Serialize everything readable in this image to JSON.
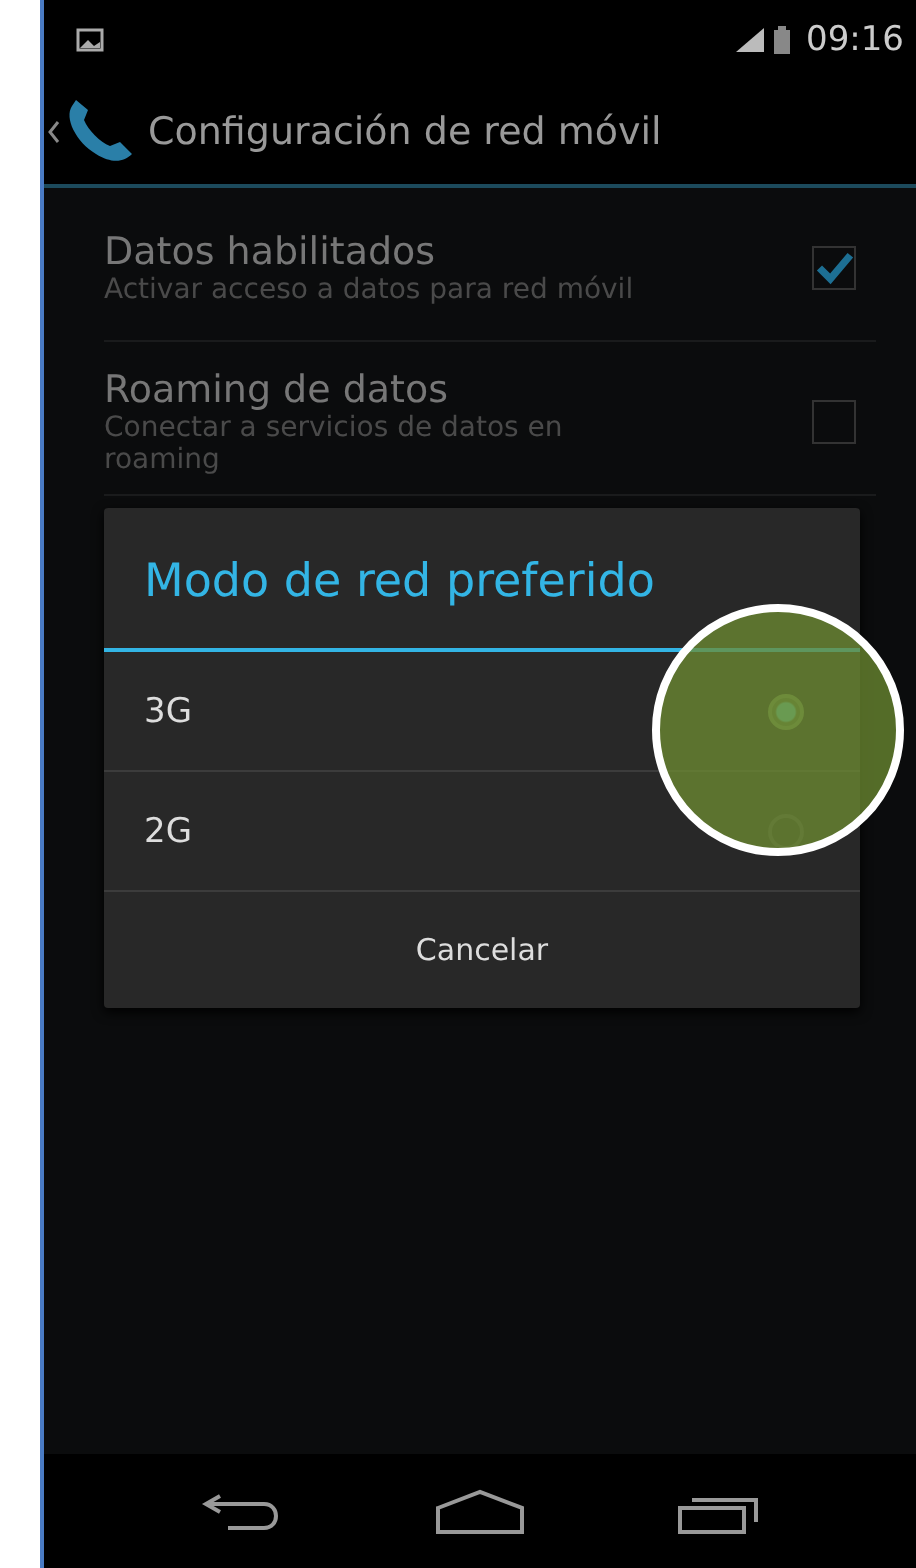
{
  "status_bar": {
    "time": "09:16"
  },
  "action_bar": {
    "title": "Configuración de red móvil"
  },
  "settings": [
    {
      "title": "Datos habilitados",
      "summary": "Activar acceso a datos para red móvil",
      "checked": true
    },
    {
      "title": "Roaming de datos",
      "summary": "Conectar a servicios de datos en roaming",
      "checked": false
    }
  ],
  "dialog": {
    "title": "Modo de red preferido",
    "options": [
      {
        "label": "3G",
        "selected": true
      },
      {
        "label": "2G",
        "selected": false
      }
    ],
    "button": "Cancelar"
  }
}
